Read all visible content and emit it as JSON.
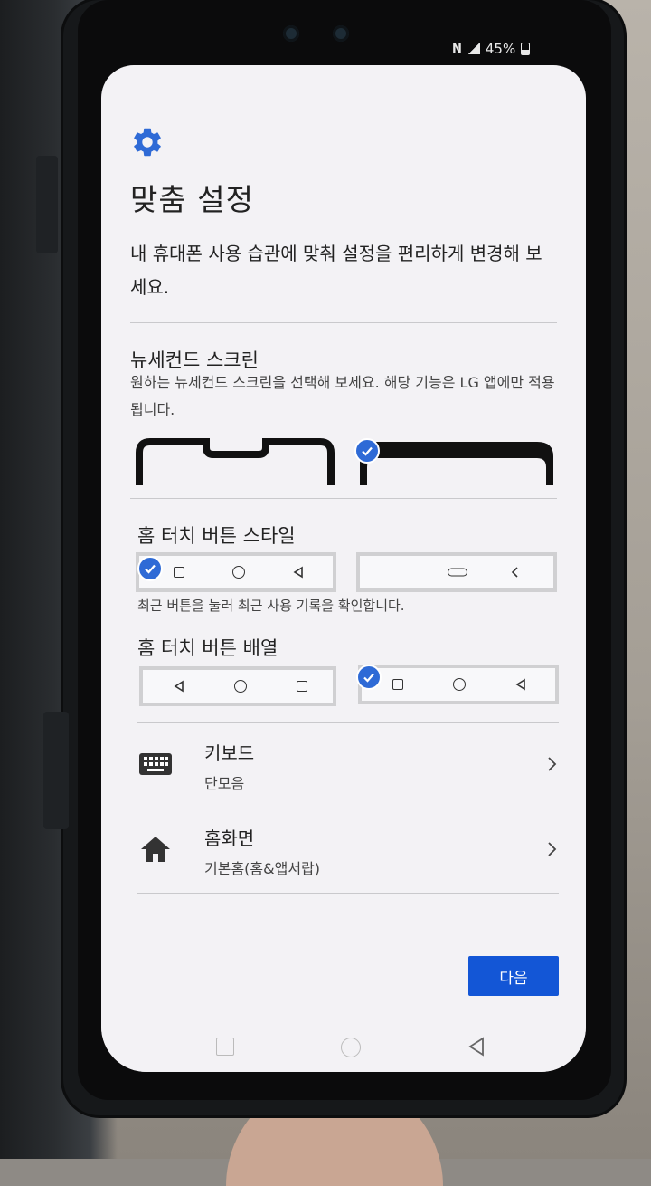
{
  "status_bar": {
    "nfc_icon": "nfc-icon",
    "battery_text": "45%"
  },
  "page": {
    "icon": "gear-icon",
    "title": "맞춤 설정",
    "subtitle": "내 휴대폰 사용 습관에 맞춰 설정을 편리하게 변경해 보세요."
  },
  "second_screen": {
    "title": "뉴세컨드 스크린",
    "desc": "원하는 뉴세컨드 스크린을 선택해 보세요. 해당 기능은 LG 앱에만 적용됩니다.",
    "options": [
      {
        "name": "notch-style",
        "selected": false
      },
      {
        "name": "full-style",
        "selected": true
      }
    ]
  },
  "home_touch_style": {
    "title": "홈 터치 버튼 스타일",
    "desc": "최근 버튼을 눌러 최근 사용 기록을 확인합니다.",
    "options": [
      {
        "icons": [
          "recents-square-icon",
          "home-circle-icon",
          "back-triangle-icon"
        ],
        "selected": true
      },
      {
        "icons": [
          "home-pill-icon",
          "back-chevron-icon"
        ],
        "selected": false
      }
    ]
  },
  "home_touch_order": {
    "title": "홈 터치 버튼 배열",
    "options": [
      {
        "icons": [
          "back-triangle-icon",
          "home-circle-icon",
          "recents-square-icon"
        ],
        "selected": false
      },
      {
        "icons": [
          "recents-square-icon",
          "home-circle-icon",
          "back-triangle-icon"
        ],
        "selected": true
      }
    ]
  },
  "rows": [
    {
      "icon": "keyboard-icon",
      "title": "키보드",
      "value": "단모음"
    },
    {
      "icon": "home-icon",
      "title": "홈화면",
      "value": "기본홈(홈&앱서랍)"
    }
  ],
  "next_button": "다음",
  "system_nav": [
    "recents-icon",
    "home-icon",
    "back-icon"
  ],
  "colors": {
    "accent": "#2e6ad6",
    "button": "#1356d6"
  }
}
